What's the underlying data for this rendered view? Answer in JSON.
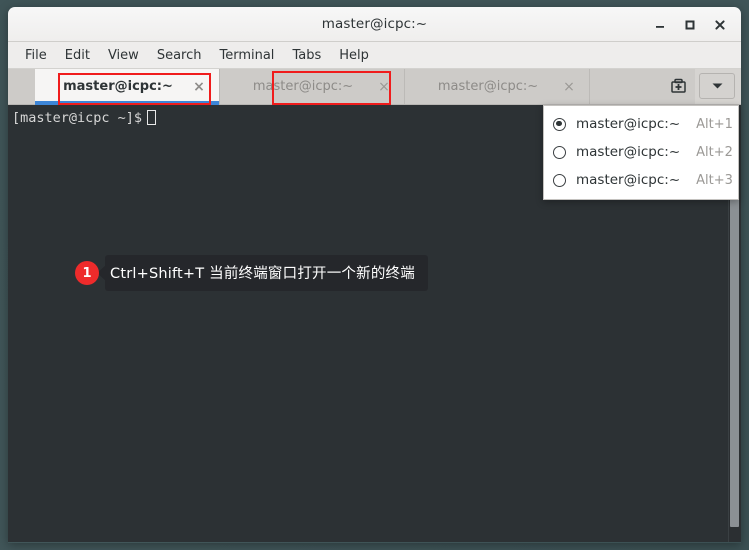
{
  "window": {
    "title": "master@icpc:~",
    "controls": [
      {
        "name": "minimize-button",
        "glyph": "minimize-icon"
      },
      {
        "name": "maximize-button",
        "glyph": "maximize-icon"
      },
      {
        "name": "close-button",
        "glyph": "close-icon"
      }
    ]
  },
  "menubar": {
    "items": [
      {
        "label": "File"
      },
      {
        "label": "Edit"
      },
      {
        "label": "View"
      },
      {
        "label": "Search"
      },
      {
        "label": "Terminal"
      },
      {
        "label": "Tabs"
      },
      {
        "label": "Help"
      }
    ]
  },
  "tabbar": {
    "tabs": [
      {
        "label": "master@icpc:~",
        "close": "×",
        "active": true
      },
      {
        "label": "master@icpc:~",
        "close": "×",
        "active": false
      },
      {
        "label": "master@icpc:~",
        "close": "×",
        "active": false
      }
    ],
    "new_tab_icon": "new-terminal-icon",
    "menu_button_icon": "chevron-down-icon"
  },
  "tab_menu": {
    "items": [
      {
        "label": "master@icpc:~",
        "accel": "Alt+1",
        "selected": true
      },
      {
        "label": "master@icpc:~",
        "accel": "Alt+2",
        "selected": false
      },
      {
        "label": "master@icpc:~",
        "accel": "Alt+3",
        "selected": false
      }
    ]
  },
  "terminal": {
    "prompt_line": "[master@icpc ~]$",
    "cursor": "block-cursor"
  },
  "callout": {
    "number": "1",
    "text": "Ctrl+Shift+T 当前终端窗口打开一个新的终端"
  },
  "colors": {
    "terminal_bg": "#2c3134",
    "desktop_bg": "#3f5457",
    "accent_tab_underline": "#3d86d8",
    "annotation_red": "#f01c1c",
    "callout_bg": "#25272b",
    "badge_red": "#ee2b2b"
  }
}
